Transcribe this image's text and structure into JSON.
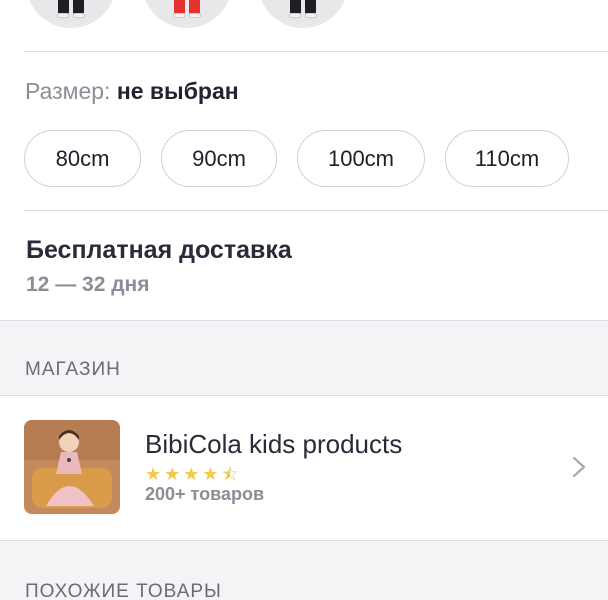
{
  "variants": [
    {
      "name": "black",
      "color": "#1e1e24"
    },
    {
      "name": "red",
      "color": "#e5322f"
    },
    {
      "name": "black-2",
      "color": "#1e1e24"
    }
  ],
  "size": {
    "label": "Размер:",
    "value": "не выбран",
    "options": [
      "80cm",
      "90cm",
      "100cm",
      "110cm"
    ]
  },
  "delivery": {
    "title": "Бесплатная доставка",
    "days": "12 — 32 дня"
  },
  "store_section": {
    "title": "МАГАЗИН"
  },
  "store": {
    "name": "BibiCola kids products",
    "rating": 4.5,
    "stars_display": "★★★★⯪",
    "count": "200+ товаров"
  },
  "similar_section": {
    "title": "ПОХОЖИЕ ТОВАРЫ"
  },
  "colors": {
    "star": "#f2c94c",
    "muted_text": "#8d8d98",
    "section_bg": "#f4f4f6"
  }
}
